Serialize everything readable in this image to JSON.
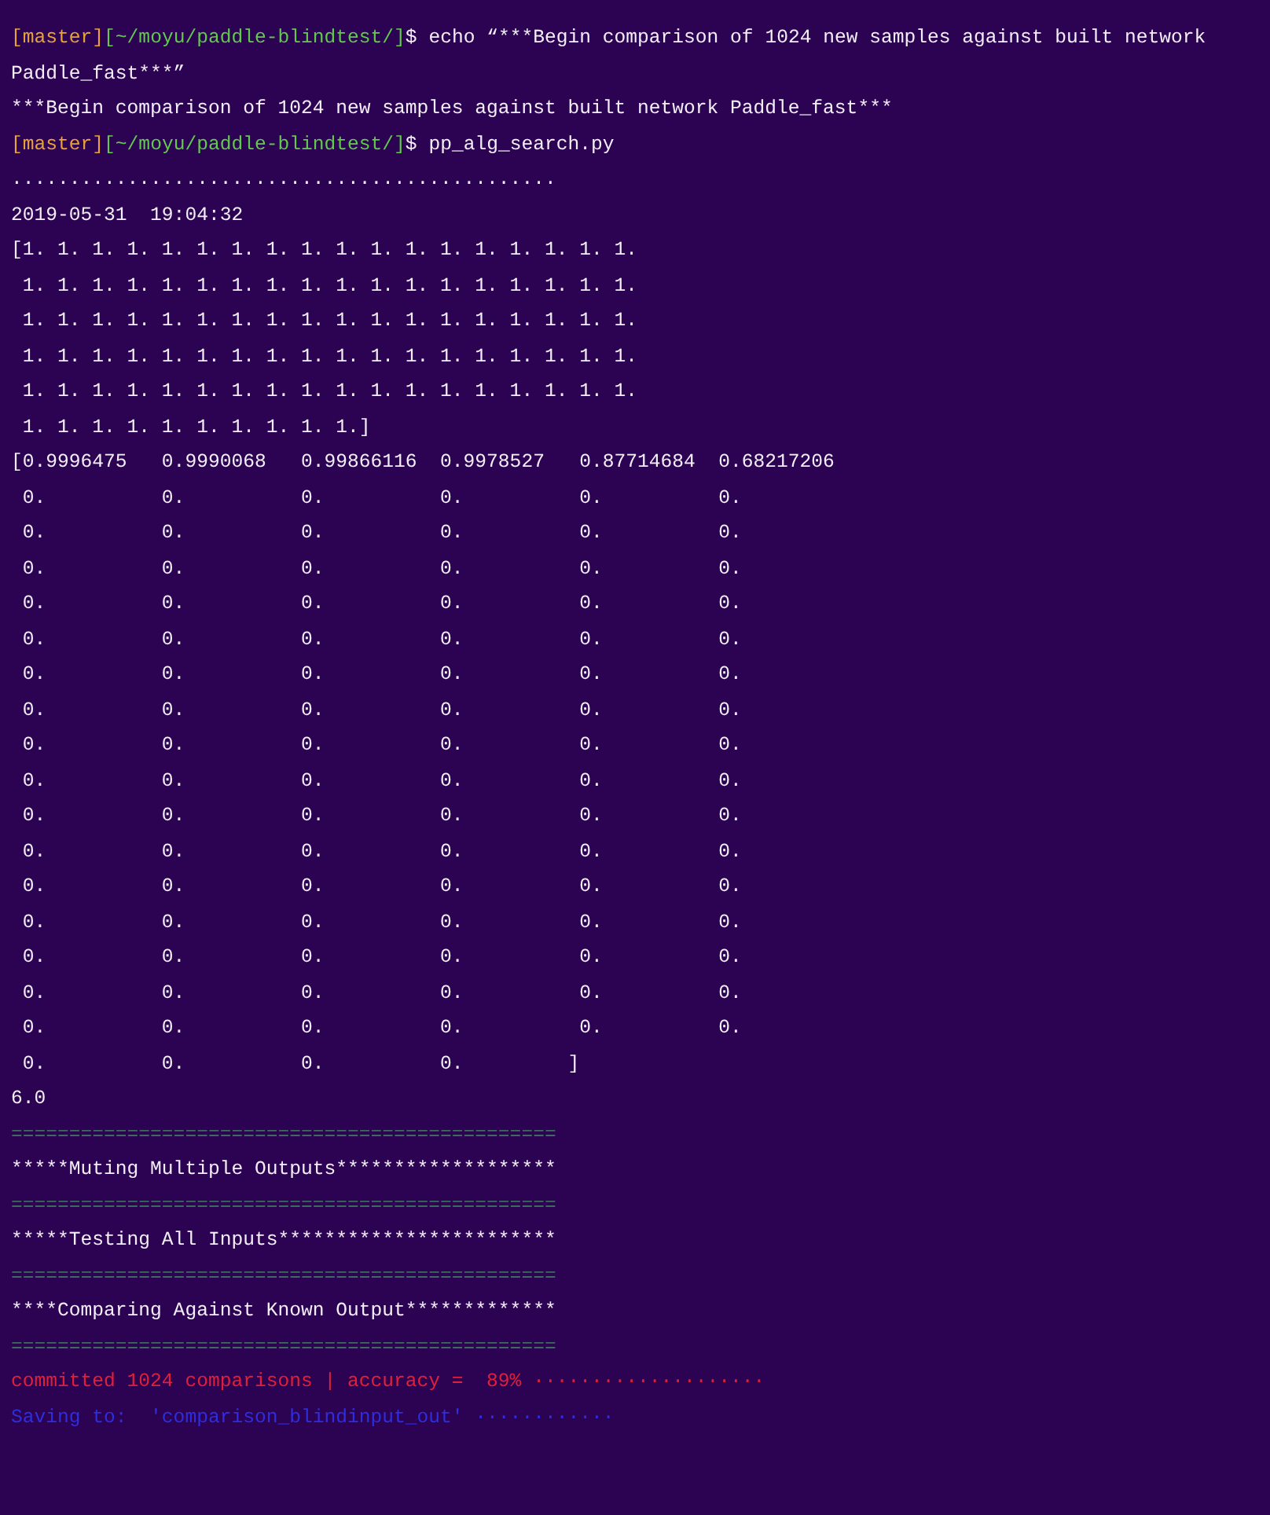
{
  "terminal": {
    "lines": [
      {
        "kind": "prompt",
        "branch": "[master]",
        "path": "[~/moyu/paddle-blindtest/]",
        "symbol": "$",
        "command": " echo “***Begin comparison of 1024 new samples against built network"
      },
      {
        "kind": "text",
        "text": "Paddle_fast***”"
      },
      {
        "kind": "text",
        "text": "***Begin comparison of 1024 new samples against built network Paddle_fast***"
      },
      {
        "kind": "prompt",
        "branch": "[master]",
        "path": "[~/moyu/paddle-blindtest/]",
        "symbol": "$",
        "command": " pp_alg_search.py"
      },
      {
        "kind": "text",
        "text": "..............................................."
      },
      {
        "kind": "text",
        "text": "2019-05-31  19:04:32"
      },
      {
        "kind": "text",
        "text": "[1. 1. 1. 1. 1. 1. 1. 1. 1. 1. 1. 1. 1. 1. 1. 1. 1. 1."
      },
      {
        "kind": "text",
        "text": " 1. 1. 1. 1. 1. 1. 1. 1. 1. 1. 1. 1. 1. 1. 1. 1. 1. 1."
      },
      {
        "kind": "text",
        "text": " 1. 1. 1. 1. 1. 1. 1. 1. 1. 1. 1. 1. 1. 1. 1. 1. 1. 1."
      },
      {
        "kind": "text",
        "text": " 1. 1. 1. 1. 1. 1. 1. 1. 1. 1. 1. 1. 1. 1. 1. 1. 1. 1."
      },
      {
        "kind": "text",
        "text": " 1. 1. 1. 1. 1. 1. 1. 1. 1. 1. 1. 1. 1. 1. 1. 1. 1. 1."
      },
      {
        "kind": "text",
        "text": " 1. 1. 1. 1. 1. 1. 1. 1. 1. 1.]"
      },
      {
        "kind": "text",
        "text": "[0.9996475   0.9990068   0.99866116  0.9978527   0.87714684  0.68217206"
      },
      {
        "kind": "text",
        "text": " 0.          0.          0.          0.          0.          0."
      },
      {
        "kind": "text",
        "text": " 0.          0.          0.          0.          0.          0."
      },
      {
        "kind": "text",
        "text": " 0.          0.          0.          0.          0.          0."
      },
      {
        "kind": "text",
        "text": " 0.          0.          0.          0.          0.          0."
      },
      {
        "kind": "text",
        "text": " 0.          0.          0.          0.          0.          0."
      },
      {
        "kind": "text",
        "text": " 0.          0.          0.          0.          0.          0."
      },
      {
        "kind": "text",
        "text": " 0.          0.          0.          0.          0.          0."
      },
      {
        "kind": "text",
        "text": " 0.          0.          0.          0.          0.          0."
      },
      {
        "kind": "text",
        "text": " 0.          0.          0.          0.          0.          0."
      },
      {
        "kind": "text",
        "text": " 0.          0.          0.          0.          0.          0."
      },
      {
        "kind": "text",
        "text": " 0.          0.          0.          0.          0.          0."
      },
      {
        "kind": "text",
        "text": " 0.          0.          0.          0.          0.          0."
      },
      {
        "kind": "text",
        "text": " 0.          0.          0.          0.          0.          0."
      },
      {
        "kind": "text",
        "text": " 0.          0.          0.          0.          0.          0."
      },
      {
        "kind": "text",
        "text": " 0.          0.          0.          0.          0.          0."
      },
      {
        "kind": "text",
        "text": " 0.          0.          0.          0.          0.          0."
      },
      {
        "kind": "text",
        "text": " 0.          0.          0.          0.         ]"
      },
      {
        "kind": "text",
        "text": "6.0"
      },
      {
        "kind": "rule",
        "text": "==============================================="
      },
      {
        "kind": "text",
        "text": "*****Muting Multiple Outputs*******************"
      },
      {
        "kind": "rule",
        "text": "==============================================="
      },
      {
        "kind": "text",
        "text": "*****Testing All Inputs************************"
      },
      {
        "kind": "rule",
        "text": "==============================================="
      },
      {
        "kind": "text",
        "text": "****Comparing Against Known Output*************"
      },
      {
        "kind": "rule",
        "text": "==============================================="
      },
      {
        "kind": "error",
        "text": "committed 1024 comparisons | accuracy =  89% ····················"
      },
      {
        "kind": "info",
        "text": "Saving to:  'comparison_blindinput_out' ············"
      }
    ]
  }
}
